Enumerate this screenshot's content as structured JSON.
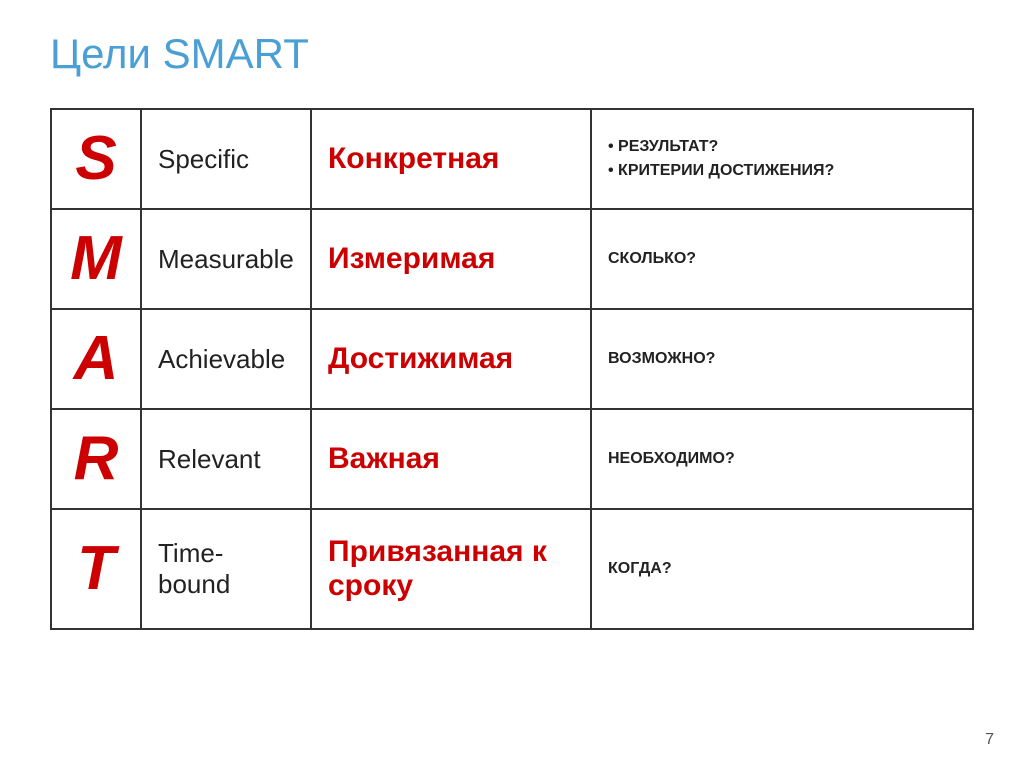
{
  "page": {
    "title": "Цели SMART",
    "page_number": "7"
  },
  "table": {
    "rows": [
      {
        "letter": "S",
        "english": "Specific",
        "russian": "Конкретная",
        "description_lines": [
          "• РЕЗУЛЬТАТ?",
          "• КРИТЕРИИ ДОСТИЖЕНИЯ?"
        ]
      },
      {
        "letter": "M",
        "english": "Measurable",
        "russian": "Измеримая",
        "description_lines": [
          "СКОЛЬКО?"
        ]
      },
      {
        "letter": "A",
        "english": "Achievable",
        "russian": "Достижимая",
        "description_lines": [
          "ВОЗМОЖНО?"
        ]
      },
      {
        "letter": "R",
        "english": "Relevant",
        "russian": "Важная",
        "description_lines": [
          "НЕОБХОДИМО?"
        ]
      },
      {
        "letter": "T",
        "english": "Time-bound",
        "russian": "Привязанная к сроку",
        "description_lines": [
          "КОГДА?"
        ]
      }
    ]
  }
}
